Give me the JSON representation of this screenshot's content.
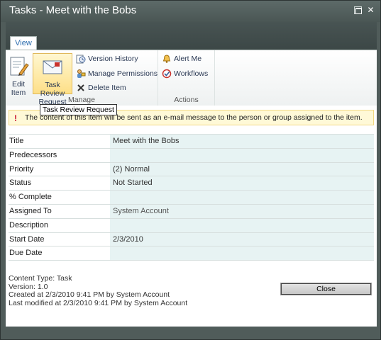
{
  "window": {
    "title": "Tasks - Meet with the Bobs",
    "maximize_icon": "maximize-icon",
    "close_glyph": "✕"
  },
  "ribbon": {
    "tab_label": "View",
    "manage": {
      "label": "Manage",
      "edit_item": {
        "line1": "Edit",
        "line2": "Item",
        "icon": "edit-item-icon"
      },
      "task_review": {
        "line1": "Task Review",
        "line2": "Request",
        "icon": "envelope-icon"
      },
      "version_history": {
        "label": "Version History",
        "icon": "version-history-icon"
      },
      "manage_permissions": {
        "label": "Manage Permissions",
        "icon": "permissions-icon"
      },
      "delete_item": {
        "label": "Delete Item",
        "icon": "delete-icon"
      }
    },
    "actions": {
      "label": "Actions",
      "alert_me": {
        "label": "Alert Me",
        "icon": "alert-icon"
      },
      "workflows": {
        "label": "Workflows",
        "icon": "workflows-icon"
      }
    }
  },
  "tooltip": "Task Review Request",
  "notice": {
    "icon": "warning-icon",
    "glyph": "!",
    "text": "The content of this item will be sent as an e-mail message to the person or group assigned to the item."
  },
  "fields": [
    {
      "label": "Title",
      "value": "Meet with the Bobs"
    },
    {
      "label": "Predecessors",
      "value": ""
    },
    {
      "label": "Priority",
      "value": "(2) Normal"
    },
    {
      "label": "Status",
      "value": "Not Started"
    },
    {
      "label": "% Complete",
      "value": ""
    },
    {
      "label": "Assigned To",
      "value": "System Account"
    },
    {
      "label": "Description",
      "value": ""
    },
    {
      "label": "Start Date",
      "value": "2/3/2010"
    },
    {
      "label": "Due Date",
      "value": ""
    }
  ],
  "meta": {
    "content_type": "Content Type: Task",
    "version": "Version: 1.0",
    "created": "Created at 2/3/2010 9:41 PM  by System Account",
    "modified": "Last modified at 2/3/2010 9:41 PM  by System Account"
  },
  "close_button": "Close",
  "colors": {
    "chrome": "#505c5a",
    "value_bg": "#e7f3f3",
    "notice_bg": "#fff9d7",
    "selected_button": "#fddf87"
  }
}
